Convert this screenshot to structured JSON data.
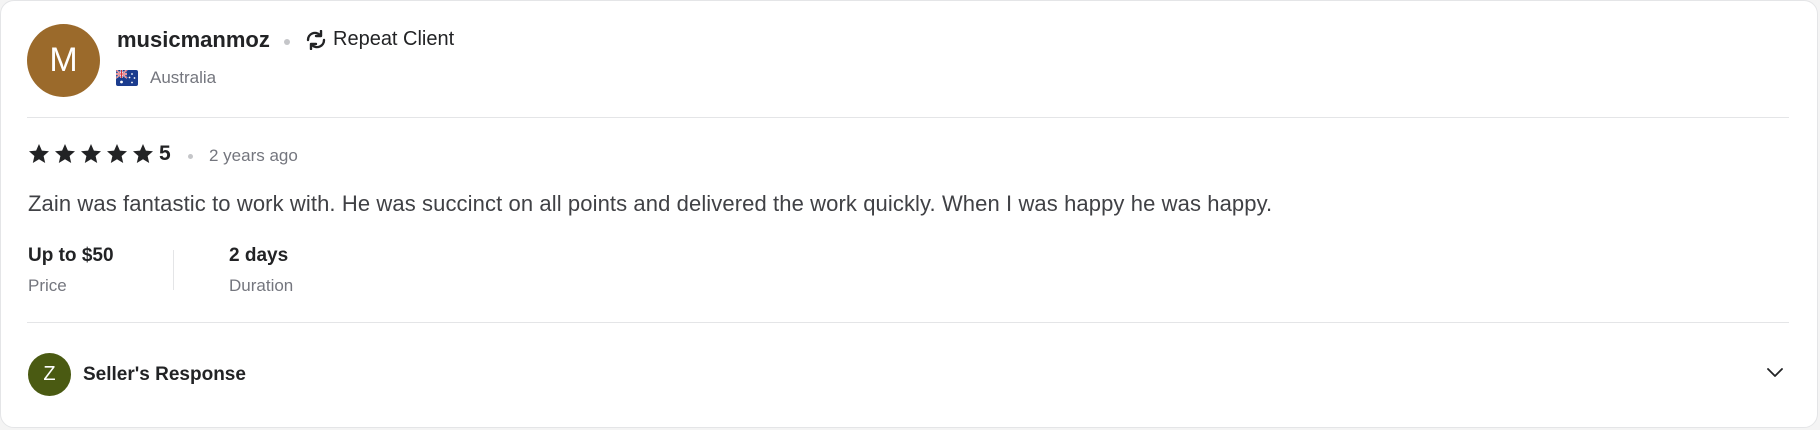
{
  "reviewer": {
    "avatar_initial": "M",
    "avatar_color": "#9b6a2b",
    "username": "musicmanmoz",
    "badge_label": "Repeat Client",
    "badge_icon": "repeat-icon",
    "country": "Australia",
    "country_flag_icon": "australia-flag-icon"
  },
  "review": {
    "rating": 5,
    "rating_label": "5",
    "star_color": "#222325",
    "time_ago": "2 years ago",
    "text": "Zain was fantastic to work with. He was succinct on all points and delivered the work quickly. When I was happy he was happy."
  },
  "meta": {
    "price_value": "Up to $50",
    "price_label": "Price",
    "duration_value": "2 days",
    "duration_label": "Duration"
  },
  "seller_response": {
    "avatar_initial": "Z",
    "avatar_color": "#4a5a12",
    "label": "Seller's Response",
    "toggle_icon": "chevron-down-icon"
  }
}
